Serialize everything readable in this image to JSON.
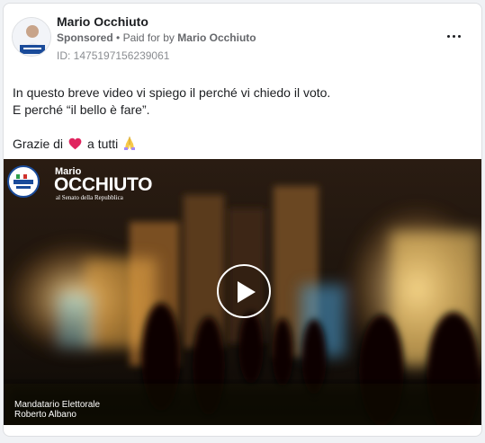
{
  "post": {
    "author": "Mario Occhiuto",
    "sponsored_label": "Sponsored",
    "separator": "•",
    "paid_for_prefix": "Paid for by",
    "paid_for_name": "Mario Occhiuto",
    "ad_id": "ID: 1475197156239061",
    "more_icon": "more-horizontal-icon",
    "text": {
      "line1": "In questo breve video vi spiego il perché vi chiedo il voto.",
      "line2": "E perché “il bello è fare”.",
      "line3_start": "Grazie di",
      "line3_mid": "a tutti",
      "heart_icon": "red-heart-emoji",
      "hands_icon": "folded-hands-emoji",
      "heart_color": "#e0245e"
    }
  },
  "video": {
    "brand_first": "Mario",
    "brand_last": "OCCHIUTO",
    "brand_sub": "al Senato della Repubblica",
    "caption_line1": "Mandatario Elettorale",
    "caption_line2": "Roberto Albano",
    "play_icon": "play-icon"
  }
}
